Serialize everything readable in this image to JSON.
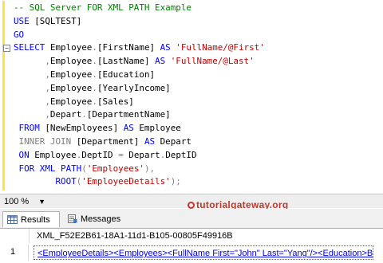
{
  "editor": {
    "lines": [
      [
        {
          "t": "-- SQL Server FOR XML PATH Example",
          "c": "c-com"
        }
      ],
      [
        {
          "t": "USE ",
          "c": "c-kw"
        },
        {
          "t": "[SQLTEST]",
          "c": "c-txt"
        }
      ],
      [
        {
          "t": "GO",
          "c": "c-kw"
        }
      ],
      [
        {
          "t": "SELECT ",
          "c": "c-kw"
        },
        {
          "t": "Employee",
          "c": "c-txt"
        },
        {
          "t": ".",
          "c": "c-gray"
        },
        {
          "t": "[FirstName] ",
          "c": "c-txt"
        },
        {
          "t": "AS ",
          "c": "c-kw"
        },
        {
          "t": "'FullName/@First'",
          "c": "c-str"
        }
      ],
      [
        {
          "t": "      ",
          "c": "c-txt"
        },
        {
          "t": ",",
          "c": "c-gray"
        },
        {
          "t": "Employee",
          "c": "c-txt"
        },
        {
          "t": ".",
          "c": "c-gray"
        },
        {
          "t": "[LastName] ",
          "c": "c-txt"
        },
        {
          "t": "AS ",
          "c": "c-kw"
        },
        {
          "t": "'FullName/@Last'",
          "c": "c-str"
        }
      ],
      [
        {
          "t": "      ",
          "c": "c-txt"
        },
        {
          "t": ",",
          "c": "c-gray"
        },
        {
          "t": "Employee",
          "c": "c-txt"
        },
        {
          "t": ".",
          "c": "c-gray"
        },
        {
          "t": "[Education]",
          "c": "c-txt"
        }
      ],
      [
        {
          "t": "      ",
          "c": "c-txt"
        },
        {
          "t": ",",
          "c": "c-gray"
        },
        {
          "t": "Employee",
          "c": "c-txt"
        },
        {
          "t": ".",
          "c": "c-gray"
        },
        {
          "t": "[YearlyIncome]",
          "c": "c-txt"
        }
      ],
      [
        {
          "t": "      ",
          "c": "c-txt"
        },
        {
          "t": ",",
          "c": "c-gray"
        },
        {
          "t": "Employee",
          "c": "c-txt"
        },
        {
          "t": ".",
          "c": "c-gray"
        },
        {
          "t": "[Sales]",
          "c": "c-txt"
        }
      ],
      [
        {
          "t": "      ",
          "c": "c-txt"
        },
        {
          "t": ",",
          "c": "c-gray"
        },
        {
          "t": "Depart",
          "c": "c-txt"
        },
        {
          "t": ".",
          "c": "c-gray"
        },
        {
          "t": "[DepartmentName]",
          "c": "c-txt"
        }
      ],
      [
        {
          "t": " FROM ",
          "c": "c-kw"
        },
        {
          "t": "[NewEmployees] ",
          "c": "c-txt"
        },
        {
          "t": "AS ",
          "c": "c-kw"
        },
        {
          "t": "Employee",
          "c": "c-txt"
        }
      ],
      [
        {
          "t": " INNER JOIN ",
          "c": "c-gray"
        },
        {
          "t": "[Department] ",
          "c": "c-txt"
        },
        {
          "t": "AS ",
          "c": "c-kw"
        },
        {
          "t": "Depart",
          "c": "c-txt"
        }
      ],
      [
        {
          "t": " ON ",
          "c": "c-kw"
        },
        {
          "t": "Employee",
          "c": "c-txt"
        },
        {
          "t": ".",
          "c": "c-gray"
        },
        {
          "t": "DeptID ",
          "c": "c-txt"
        },
        {
          "t": "= ",
          "c": "c-gray"
        },
        {
          "t": "Depart",
          "c": "c-txt"
        },
        {
          "t": ".",
          "c": "c-gray"
        },
        {
          "t": "DeptID",
          "c": "c-txt"
        }
      ],
      [
        {
          "t": " FOR XML PATH",
          "c": "c-kw"
        },
        {
          "t": "(",
          "c": "c-gray"
        },
        {
          "t": "'Employees'",
          "c": "c-str"
        },
        {
          "t": "),",
          "c": "c-gray"
        }
      ],
      [
        {
          "t": "        ",
          "c": "c-txt"
        },
        {
          "t": "ROOT",
          "c": "c-kw"
        },
        {
          "t": "(",
          "c": "c-gray"
        },
        {
          "t": "'EmployeeDetails'",
          "c": "c-str"
        },
        {
          "t": ");",
          "c": "c-gray"
        }
      ]
    ],
    "collapse_symbol": "−"
  },
  "statusbar": {
    "zoom_value": "100 %",
    "zoom_arrow": "▼"
  },
  "watermark": {
    "text": "tutorialgateway.org"
  },
  "tabs": {
    "results_label": "Results",
    "messages_label": "Messages"
  },
  "grid": {
    "column_header": "XML_F52E2B61-18A1-11d1-B105-00805F49916B",
    "rows": [
      {
        "number": "1",
        "value": "<EmployeeDetails><Employees><FullName First=\"John\" Last=\"Yang\"/><Education>B..."
      }
    ]
  },
  "colors": {
    "keyword": "#0000ff",
    "string": "#c00000",
    "comment": "#008000",
    "gray": "#808080",
    "link": "#0000ee",
    "watermark": "#c0392b"
  }
}
